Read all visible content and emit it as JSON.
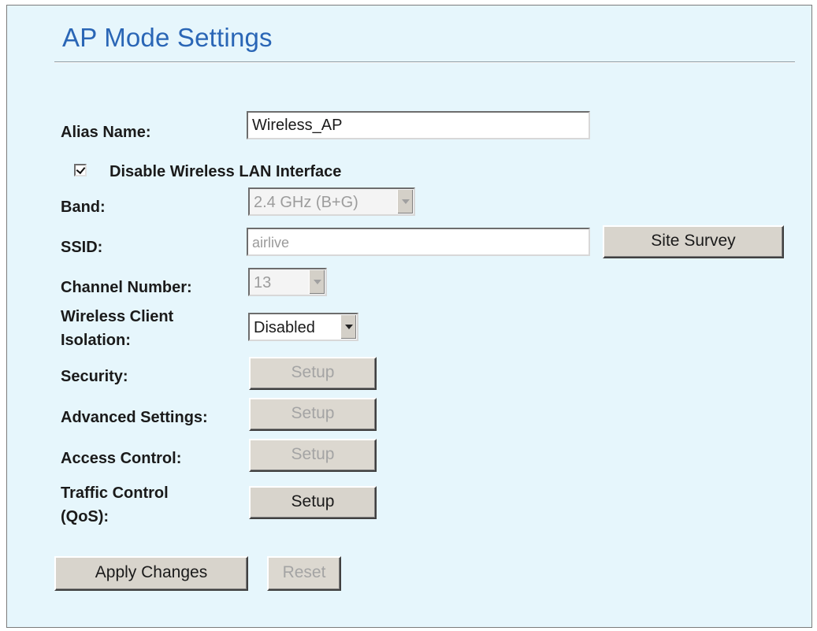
{
  "page_title": "AP Mode Settings",
  "alias": {
    "label": "Alias Name:",
    "value": "Wireless_AP"
  },
  "disable_wlan": {
    "label": "Disable Wireless LAN Interface",
    "checked": true
  },
  "band": {
    "label": "Band:",
    "value": "2.4 GHz (B+G)",
    "disabled": true
  },
  "ssid": {
    "label": "SSID:",
    "value": "airlive",
    "disabled": true,
    "site_survey_label": "Site Survey"
  },
  "channel": {
    "label": "Channel Number:",
    "value": "13",
    "disabled": true
  },
  "client_isolation": {
    "label_line1": "Wireless Client",
    "label_line2": "Isolation:",
    "value": "Disabled"
  },
  "security": {
    "label": "Security:",
    "button": "Setup",
    "disabled": true
  },
  "advanced": {
    "label": "Advanced Settings:",
    "button": "Setup",
    "disabled": true
  },
  "access_control": {
    "label": "Access Control:",
    "button": "Setup",
    "disabled": true
  },
  "traffic_control": {
    "label_line1": "Traffic Control",
    "label_line2": "(QoS):",
    "button": "Setup",
    "disabled": false
  },
  "actions": {
    "apply_label": "Apply Changes",
    "reset_label": "Reset",
    "reset_disabled": true
  }
}
